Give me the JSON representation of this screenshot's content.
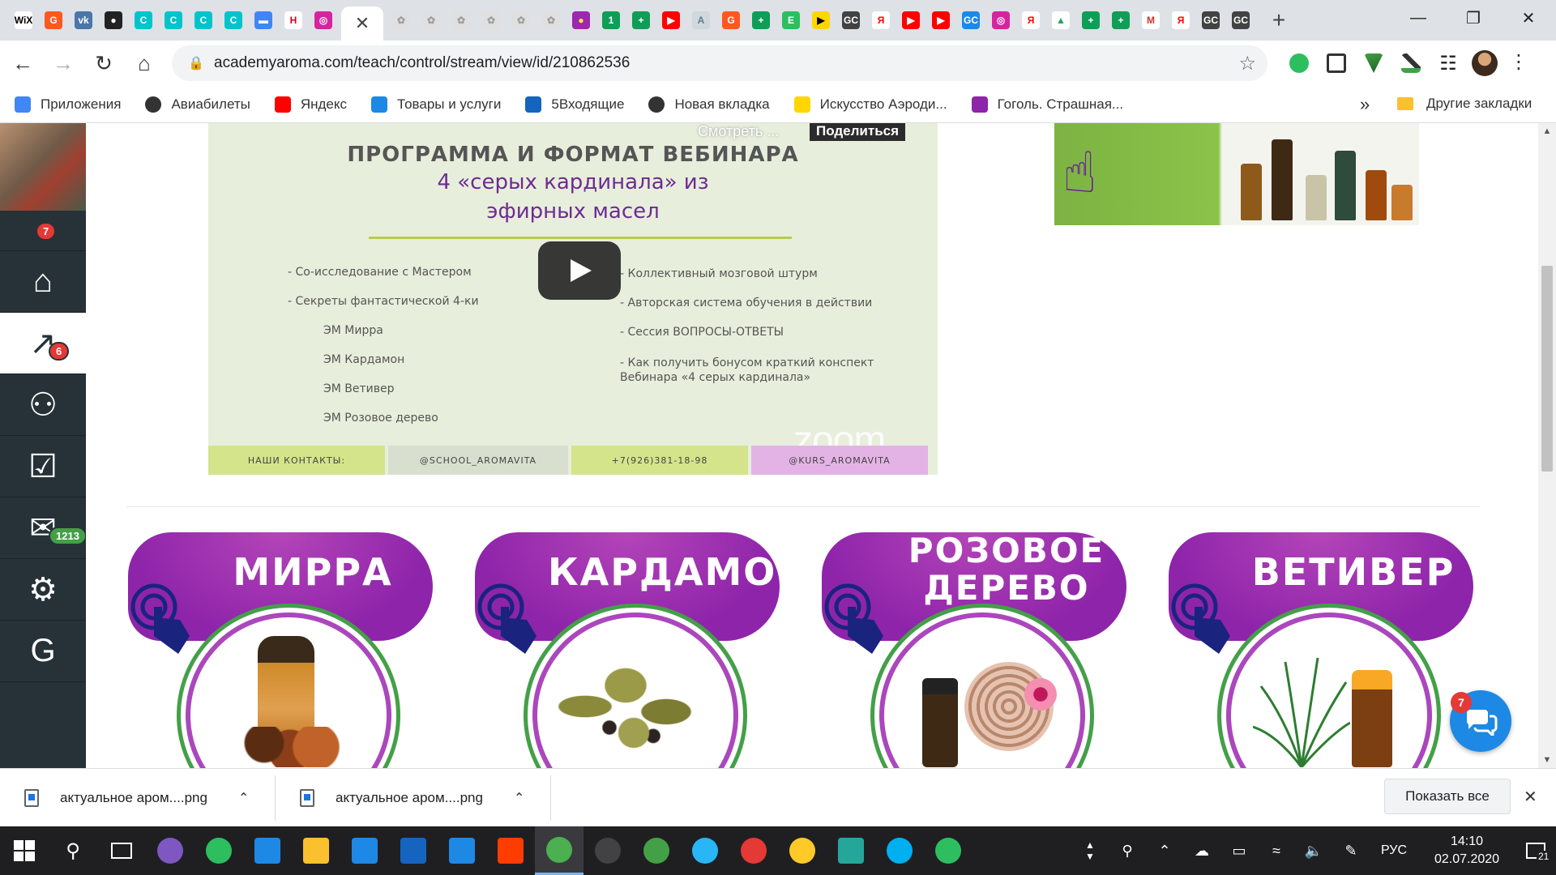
{
  "tabs": {
    "favicons": [
      {
        "icon": "wix-icon",
        "text": "WiX",
        "color": "#ffffff",
        "fg": "#000000"
      },
      {
        "icon": "refresh-brand-icon",
        "text": "G",
        "color": "#ff5722",
        "fg": "#ffffff"
      },
      {
        "icon": "vk-icon",
        "text": "vk",
        "color": "#4a76a8",
        "fg": "#ffffff"
      },
      {
        "icon": "record-icon",
        "text": "●",
        "color": "#222222",
        "fg": "#ffffff"
      },
      {
        "icon": "canva-icon",
        "text": "C",
        "color": "#00c4cc",
        "fg": "#ffffff"
      },
      {
        "icon": "canva-icon",
        "text": "C",
        "color": "#00c4cc",
        "fg": "#ffffff"
      },
      {
        "icon": "canva-icon",
        "text": "C",
        "color": "#00c4cc",
        "fg": "#ffffff"
      },
      {
        "icon": "canva-icon",
        "text": "C",
        "color": "#00c4cc",
        "fg": "#ffffff"
      },
      {
        "icon": "chat-icon",
        "text": "▬",
        "color": "#4285f4",
        "fg": "#ffffff"
      },
      {
        "icon": "hh-icon",
        "text": "H",
        "color": "#ffffff",
        "fg": "#d6001c"
      },
      {
        "icon": "instagram-icon",
        "text": "◎",
        "color": "#d6249f",
        "fg": "#ffffff"
      },
      {
        "icon": "aroma-icon",
        "text": "✿",
        "color": "#e0e0e0",
        "fg": "#9e9e9e"
      },
      {
        "icon": "aroma-icon",
        "text": "✿",
        "color": "#e0e0e0",
        "fg": "#9e9e9e"
      },
      {
        "icon": "aroma-icon",
        "text": "✿",
        "color": "#e0e0e0",
        "fg": "#9e9e9e"
      },
      {
        "icon": "aroma-icon",
        "text": "✿",
        "color": "#e0e0e0",
        "fg": "#9e9e9e"
      },
      {
        "icon": "aroma-icon",
        "text": "✿",
        "color": "#e0e0e0",
        "fg": "#9e9e9e"
      },
      {
        "icon": "aroma-icon",
        "text": "✿",
        "color": "#e0e0e0",
        "fg": "#9e9e9e"
      },
      {
        "icon": "aroma-icon",
        "text": "✿",
        "color": "#e0e0e0",
        "fg": "#9e9e9e"
      },
      {
        "icon": "color-wheel-icon",
        "text": "●",
        "color": "#9c27b0",
        "fg": "#ffeb3b"
      },
      {
        "icon": "one-icon",
        "text": "1",
        "color": "#0f9d58",
        "fg": "#ffffff"
      },
      {
        "icon": "plus-green-icon",
        "text": "+",
        "color": "#0f9d58",
        "fg": "#ffffff"
      },
      {
        "icon": "youtube-icon",
        "text": "▶",
        "color": "#ff0000",
        "fg": "#ffffff"
      },
      {
        "icon": "pdf-icon",
        "text": "A",
        "color": "#cfd8dc",
        "fg": "#607d8b"
      },
      {
        "icon": "refresh-brand-icon",
        "text": "G",
        "color": "#ff5722",
        "fg": "#ffffff"
      },
      {
        "icon": "plus-green-icon",
        "text": "+",
        "color": "#0f9d58",
        "fg": "#ffffff"
      },
      {
        "icon": "evernote-icon",
        "text": "E",
        "color": "#2dbe60",
        "fg": "#ffffff"
      },
      {
        "icon": "play-yellow-icon",
        "text": "▶",
        "color": "#ffd600",
        "fg": "#000000"
      },
      {
        "icon": "gc-icon",
        "text": "GC",
        "color": "#424242",
        "fg": "#ffffff"
      },
      {
        "icon": "yandex-icon",
        "text": "Я",
        "color": "#ffffff",
        "fg": "#ff0000"
      },
      {
        "icon": "youtube-icon",
        "text": "▶",
        "color": "#ff0000",
        "fg": "#ffffff"
      },
      {
        "icon": "youtube-icon",
        "text": "▶",
        "color": "#ff0000",
        "fg": "#ffffff"
      },
      {
        "icon": "gc-blue-icon",
        "text": "GC",
        "color": "#1e88e5",
        "fg": "#ffffff"
      },
      {
        "icon": "instagram-icon",
        "text": "◎",
        "color": "#d6249f",
        "fg": "#ffffff"
      },
      {
        "icon": "yandex-icon",
        "text": "Я",
        "color": "#ffffff",
        "fg": "#ff0000"
      },
      {
        "icon": "drive-icon",
        "text": "▲",
        "color": "#ffffff",
        "fg": "#1fa463"
      },
      {
        "icon": "plus-green-icon",
        "text": "+",
        "color": "#0f9d58",
        "fg": "#ffffff"
      },
      {
        "icon": "plus-green-icon",
        "text": "+",
        "color": "#0f9d58",
        "fg": "#ffffff"
      },
      {
        "icon": "gmail-icon",
        "text": "M",
        "color": "#ffffff",
        "fg": "#d93025"
      },
      {
        "icon": "yandex-icon",
        "text": "Я",
        "color": "#ffffff",
        "fg": "#ff0000"
      },
      {
        "icon": "gc-icon",
        "text": "GC",
        "color": "#424242",
        "fg": "#ffffff"
      },
      {
        "icon": "gc-icon",
        "text": "GC",
        "color": "#424242",
        "fg": "#ffffff"
      }
    ],
    "active_index": 11
  },
  "address": {
    "url": "academyaroma.com/teach/control/stream/view/id/210862536"
  },
  "bookmarks": [
    {
      "label": "Приложения",
      "icon": "apps-grid-icon",
      "color": "#4285f4"
    },
    {
      "label": "Авиабилеты",
      "icon": "globe-icon",
      "color": "#333333"
    },
    {
      "label": "Яндекс",
      "icon": "yandex-icon",
      "color": "#ff0000"
    },
    {
      "label": "Товары и услуги",
      "icon": "shop-icon",
      "color": "#1e88e5"
    },
    {
      "label": "5Входящие",
      "icon": "mail-icon",
      "color": "#1565c0"
    },
    {
      "label": "Новая вкладка",
      "icon": "globe-icon",
      "color": "#333333"
    },
    {
      "label": "Искусство Аэроди...",
      "icon": "play-yellow-icon",
      "color": "#ffd600"
    },
    {
      "label": "Гоголь. Страшная...",
      "icon": "bookmark-purple-icon",
      "color": "#8e24aa"
    }
  ],
  "bookmarks_more": "»",
  "bookmarks_other": "Другие закладки",
  "sidebar": {
    "items": [
      {
        "icon": "notifications-icon",
        "badge": "7",
        "badge_color": "#e53935"
      },
      {
        "icon": "home-icon",
        "badge": ""
      },
      {
        "icon": "chart-icon",
        "badge": "6",
        "badge_color": "#e53935",
        "active": true
      },
      {
        "icon": "users-icon",
        "badge": ""
      },
      {
        "icon": "tasks-icon",
        "badge": ""
      },
      {
        "icon": "mail-icon",
        "badge": "1213",
        "badge_color": "#43a047"
      },
      {
        "icon": "settings-icon",
        "badge": ""
      },
      {
        "icon": "getcourse-icon",
        "badge": ""
      }
    ]
  },
  "video": {
    "watch_label": "Смотреть ...",
    "share_label": "Поделиться",
    "title": "ПРОГРАММА И ФОРМАТ ВЕБИНАРА",
    "subtitle_1": "4 «серых кардинала» из",
    "subtitle_2": "эфирных масел",
    "left_list": [
      "- Со-исследование с Мастером",
      "- Секреты фантастической 4-ки",
      "ЭМ Мирра",
      "ЭМ Кардамон",
      "ЭМ Ветивер",
      "ЭМ Розовое дерево"
    ],
    "right_list": [
      "-   Коллективный мозговой штурм",
      "-   Авторская система обучения в действии",
      "- Сессия ВОПРОСЫ-ОТВЕТЫ",
      "- Как  получить бонусом краткий конспект",
      "Вебинара «4 серых кардинала»"
    ],
    "zoom_label": "zoom",
    "contacts": [
      {
        "label": "НАШИ КОНТАКТЫ:",
        "color": "#d4e48a"
      },
      {
        "label": "@SCHOOL_AROMAVITA",
        "color": "#d9dfcf"
      },
      {
        "label": "+7(926)381-18-98",
        "color": "#d4e48a"
      },
      {
        "label": "@KURS_AROMAVITA",
        "color": "#e3b3e6"
      }
    ]
  },
  "cards": [
    {
      "label": "МИРРА",
      "product": "myrrh"
    },
    {
      "label": "КАРДАМОН",
      "product": "cardamom"
    },
    {
      "label_1": "РОЗОВОЕ",
      "label_2": "ДЕРЕВО",
      "product": "rosewood"
    },
    {
      "label": "ВЕТИВЕР",
      "product": "vetiver"
    }
  ],
  "chat_widget": {
    "badge": "7"
  },
  "downloads": {
    "items": [
      {
        "name": "актуальное аром....png"
      },
      {
        "name": "актуальное аром....png"
      }
    ],
    "show_all": "Показать все"
  },
  "taskbar": {
    "apps": [
      {
        "icon": "alice-icon",
        "color": "#7e57c2"
      },
      {
        "icon": "evernote-icon",
        "color": "#2dbe60"
      },
      {
        "icon": "edge-icon",
        "color": "#1e88e5"
      },
      {
        "icon": "explorer-icon",
        "color": "#fbc02d"
      },
      {
        "icon": "store-icon",
        "color": "#1e88e5"
      },
      {
        "icon": "b-icon",
        "color": "#1565c0"
      },
      {
        "icon": "mail-icon",
        "color": "#1e88e5"
      },
      {
        "icon": "yandex-icon",
        "color": "#ff3d00"
      },
      {
        "icon": "chrome-icon",
        "color": "#4caf50",
        "active": true
      },
      {
        "icon": "obs-icon",
        "color": "#424242"
      },
      {
        "icon": "download-icon",
        "color": "#43a047"
      },
      {
        "icon": "telegram-icon",
        "color": "#29b6f6"
      },
      {
        "icon": "record-icon",
        "color": "#e53935"
      },
      {
        "icon": "emoji-pro-icon",
        "color": "#ffca28"
      },
      {
        "icon": "screen-icon",
        "color": "#26a69a"
      },
      {
        "icon": "skype-icon",
        "color": "#00aff0"
      },
      {
        "icon": "evernote-icon",
        "color": "#2dbe60"
      }
    ],
    "language": "РУС",
    "time": "14:10",
    "date": "02.07.2020",
    "notifications": "21"
  }
}
